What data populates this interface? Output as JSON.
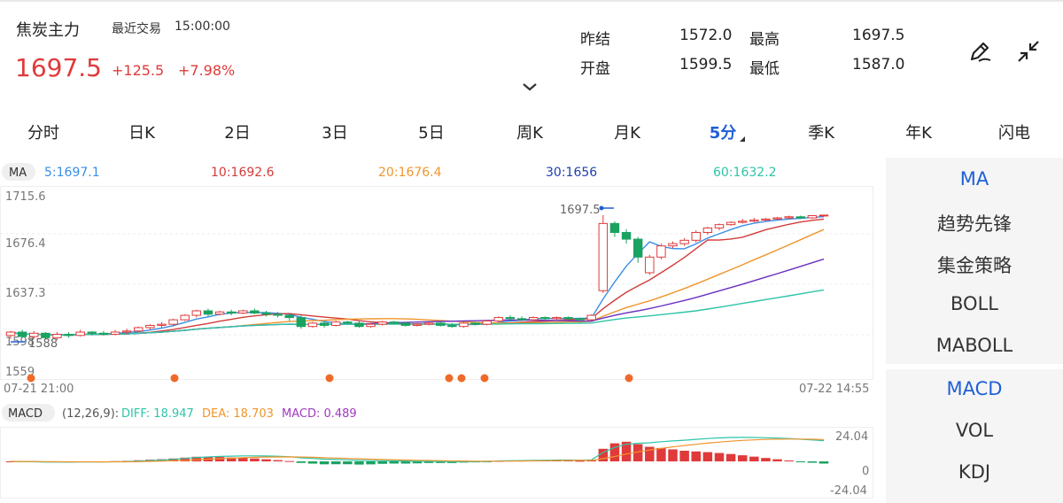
{
  "header": {
    "name": "焦炭主力",
    "last_trade_label": "最近交易",
    "last_trade_time": "15:00:00",
    "price": "1697.5",
    "change": "+125.5",
    "change_pct": "+7.98%"
  },
  "quote": {
    "prev_close_label": "昨结",
    "prev_close": "1572.0",
    "high_label": "最高",
    "high": "1697.5",
    "open_label": "开盘",
    "open": "1599.5",
    "low_label": "最低",
    "low": "1587.0"
  },
  "icons": {
    "draw": "pen-icon",
    "collapse": "collapse-icon",
    "expand": "chevron-down-icon"
  },
  "tabs": [
    {
      "label": "分时"
    },
    {
      "label": "日K"
    },
    {
      "label": "2日"
    },
    {
      "label": "3日"
    },
    {
      "label": "5日"
    },
    {
      "label": "周K"
    },
    {
      "label": "月K"
    },
    {
      "label": "5分",
      "active": true
    },
    {
      "label": "季K"
    },
    {
      "label": "年K"
    },
    {
      "label": "闪电"
    }
  ],
  "ma_legend": {
    "badge": "MA",
    "ma5": "5:1697.1",
    "ma10": "10:1692.6",
    "ma20": "20:1676.4",
    "ma30": "30:1656",
    "ma60": "60:1632.2"
  },
  "y_axis": [
    "1715.6",
    "1676.4",
    "1637.3",
    "1598",
    "1559"
  ],
  "price_markers": {
    "high_label": "1697.5",
    "low_label": "1588"
  },
  "time_axis": {
    "start": "07-21 21:00",
    "end": "07-22 14:55"
  },
  "macd_legend": {
    "badge": "MACD",
    "params": "(12,26,9):",
    "diff": "DIFF: 18.947",
    "dea": "DEA: 18.703",
    "macd": "MACD: 0.489"
  },
  "macd_axis": [
    "24.04",
    "0",
    "-24.04"
  ],
  "side_indicators": [
    "MA",
    "趋势先锋",
    "集金策略",
    "BOLL",
    "MABOLL"
  ],
  "side_sub_indicators": [
    "MACD",
    "VOL",
    "KDJ"
  ],
  "colors": {
    "up": "#e03a3a",
    "down": "#1aa260",
    "ma5": "#3a8ee6",
    "ma10": "#d23c3c",
    "ma20": "#f0952c",
    "ma30": "#6a2fc0",
    "ma60": "#2ec4a8",
    "accent": "#1f5fd6"
  },
  "chart_data": {
    "type": "candlestick",
    "period": "5分",
    "ylim": [
      1559,
      1715.6
    ],
    "candles": [
      [
        1590,
        1593,
        1587,
        1594
      ],
      [
        1593,
        1589,
        1588,
        1595
      ],
      [
        1589,
        1592,
        1587,
        1594
      ],
      [
        1592,
        1588,
        1587,
        1593
      ],
      [
        1588,
        1591,
        1586,
        1593
      ],
      [
        1591,
        1590,
        1588,
        1593
      ],
      [
        1590,
        1593,
        1589,
        1595
      ],
      [
        1593,
        1592,
        1590,
        1594
      ],
      [
        1592,
        1591,
        1590,
        1594
      ],
      [
        1591,
        1593,
        1590,
        1595
      ],
      [
        1593,
        1594,
        1591,
        1596
      ],
      [
        1594,
        1597,
        1593,
        1598
      ],
      [
        1597,
        1599,
        1595,
        1600
      ],
      [
        1599,
        1600,
        1597,
        1602
      ],
      [
        1600,
        1604,
        1598,
        1605
      ],
      [
        1604,
        1608,
        1603,
        1609
      ],
      [
        1608,
        1612,
        1606,
        1613
      ],
      [
        1612,
        1609,
        1607,
        1614
      ],
      [
        1609,
        1611,
        1608,
        1612
      ],
      [
        1611,
        1610,
        1608,
        1613
      ],
      [
        1610,
        1612,
        1609,
        1613
      ],
      [
        1612,
        1610,
        1609,
        1614
      ],
      [
        1610,
        1609,
        1607,
        1612
      ],
      [
        1609,
        1608,
        1606,
        1611
      ],
      [
        1608,
        1606,
        1603,
        1610
      ],
      [
        1606,
        1598,
        1596,
        1608
      ],
      [
        1598,
        1601,
        1597,
        1602
      ],
      [
        1601,
        1599,
        1597,
        1602
      ],
      [
        1599,
        1602,
        1598,
        1603
      ],
      [
        1602,
        1601,
        1600,
        1603
      ],
      [
        1601,
        1598,
        1597,
        1603
      ],
      [
        1598,
        1600,
        1597,
        1601
      ],
      [
        1600,
        1602,
        1599,
        1603
      ],
      [
        1602,
        1601,
        1600,
        1603
      ],
      [
        1601,
        1599,
        1598,
        1602
      ],
      [
        1599,
        1600,
        1598,
        1601
      ],
      [
        1600,
        1601,
        1599,
        1602
      ],
      [
        1601,
        1599,
        1598,
        1602
      ],
      [
        1599,
        1598,
        1597,
        1601
      ],
      [
        1598,
        1601,
        1597,
        1602
      ],
      [
        1601,
        1600,
        1599,
        1602
      ],
      [
        1600,
        1603,
        1599,
        1604
      ],
      [
        1603,
        1606,
        1602,
        1607
      ],
      [
        1606,
        1605,
        1603,
        1608
      ],
      [
        1605,
        1604,
        1603,
        1607
      ],
      [
        1604,
        1606,
        1603,
        1607
      ],
      [
        1606,
        1605,
        1604,
        1607
      ],
      [
        1605,
        1606,
        1604,
        1607
      ],
      [
        1606,
        1605,
        1604,
        1607
      ],
      [
        1605,
        1604,
        1602,
        1606
      ],
      [
        1604,
        1608,
        1603,
        1609
      ],
      [
        1630,
        1690,
        1628,
        1697.5
      ],
      [
        1690,
        1682,
        1678,
        1692
      ],
      [
        1682,
        1676,
        1672,
        1685
      ],
      [
        1676,
        1660,
        1655,
        1678
      ],
      [
        1646,
        1660,
        1644,
        1662
      ],
      [
        1660,
        1670,
        1658,
        1672
      ],
      [
        1670,
        1672,
        1668,
        1674
      ],
      [
        1672,
        1675,
        1670,
        1677
      ],
      [
        1675,
        1682,
        1673,
        1684
      ],
      [
        1682,
        1686,
        1680,
        1687
      ],
      [
        1686,
        1689,
        1684,
        1690
      ],
      [
        1689,
        1691,
        1688,
        1692
      ],
      [
        1691,
        1692,
        1690,
        1694
      ],
      [
        1692,
        1693,
        1691,
        1695
      ],
      [
        1693,
        1694,
        1692,
        1695
      ],
      [
        1694,
        1695,
        1693,
        1696
      ],
      [
        1695,
        1696,
        1694,
        1697
      ],
      [
        1696,
        1695,
        1694,
        1697
      ],
      [
        1695,
        1697,
        1694,
        1697.5
      ],
      [
        1697,
        1697.5,
        1696,
        1697.5
      ]
    ],
    "candle_fields": [
      "open",
      "close",
      "low",
      "high"
    ]
  }
}
